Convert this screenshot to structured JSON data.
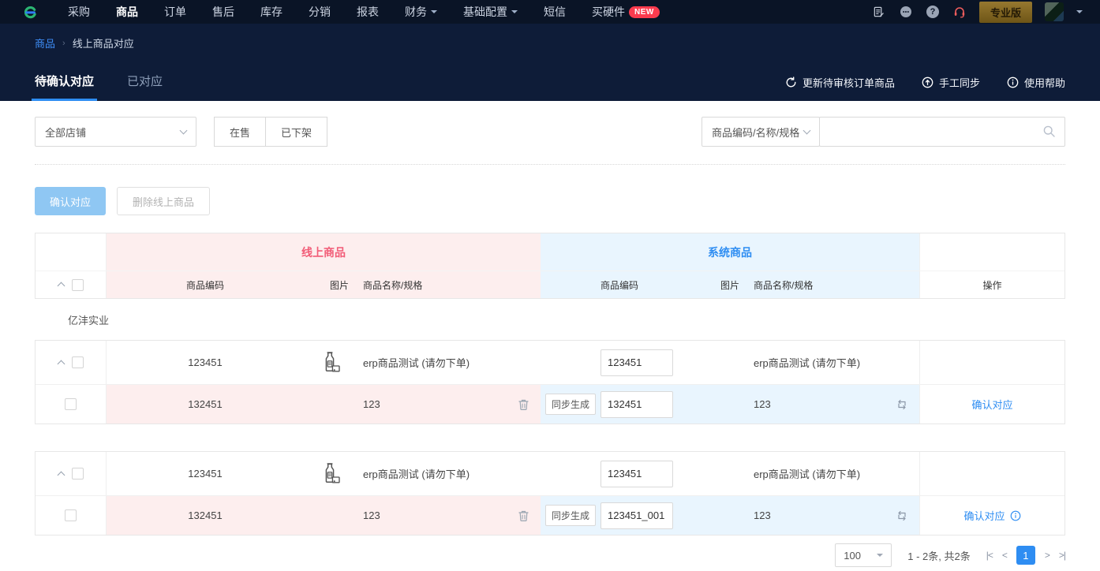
{
  "colors": {
    "accent": "#2e8df2",
    "online_accent": "#f25c77",
    "badge_red": "#fb3b4e",
    "pro_gold": "#8a6b25",
    "nav_bg": "#0a1426",
    "subhead_bg": "#0e1c38"
  },
  "nav": {
    "items": [
      {
        "label": "采购"
      },
      {
        "label": "商品"
      },
      {
        "label": "订单"
      },
      {
        "label": "售后"
      },
      {
        "label": "库存"
      },
      {
        "label": "分销"
      },
      {
        "label": "报表"
      },
      {
        "label": "财务"
      },
      {
        "label": "基础配置"
      },
      {
        "label": "短信"
      },
      {
        "label": "买硬件",
        "badge": "NEW"
      }
    ],
    "pro_label": "专业版",
    "help_glyph": "?"
  },
  "header": {
    "breadcrumb": {
      "root": "商品",
      "sep": "›",
      "current": "线上商品对应"
    },
    "tabs": [
      {
        "label": "待确认对应"
      },
      {
        "label": "已对应"
      }
    ],
    "actions": [
      {
        "label": "更新待审核订单商品"
      },
      {
        "label": "手工同步"
      },
      {
        "label": "使用帮助"
      }
    ]
  },
  "filters": {
    "shop_select": "全部店铺",
    "on_sale": "在售",
    "off_shelf": "已下架",
    "search_type": "商品编码/名称/规格",
    "search_value": ""
  },
  "toolbar": {
    "confirm_label": "确认对应",
    "delete_label": "删除线上商品"
  },
  "table": {
    "online_title": "线上商品",
    "system_title": "系统商品",
    "col_code": "商品编码",
    "col_image": "图片",
    "col_name": "商品名称/规格",
    "col_action": "操作",
    "shop_name": "亿沣实业",
    "groups": [
      {
        "parent": {
          "online_code": "123451",
          "online_name": "erp商品测试 (请勿下单)",
          "system_code": "123451",
          "system_name": "erp商品测试 (请勿下单)"
        },
        "sub": {
          "online_code": "132451",
          "online_name": "123",
          "sync_label": "同步生成",
          "system_code": "132451",
          "system_name": "123",
          "action_label": "确认对应"
        }
      },
      {
        "parent": {
          "online_code": "123451",
          "online_name": "erp商品测试 (请勿下单)",
          "system_code": "123451",
          "system_name": "erp商品测试 (请勿下单)"
        },
        "sub": {
          "online_code": "132451",
          "online_name": "123",
          "sync_label": "同步生成",
          "system_code": "123451_001",
          "system_name": "123",
          "action_label": "确认对应"
        }
      }
    ]
  },
  "pagination": {
    "page_size": "100",
    "summary": "1 - 2条, 共2条",
    "current_page": "1",
    "first": "|<",
    "prev": "<",
    "next": ">",
    "last": ">|"
  }
}
